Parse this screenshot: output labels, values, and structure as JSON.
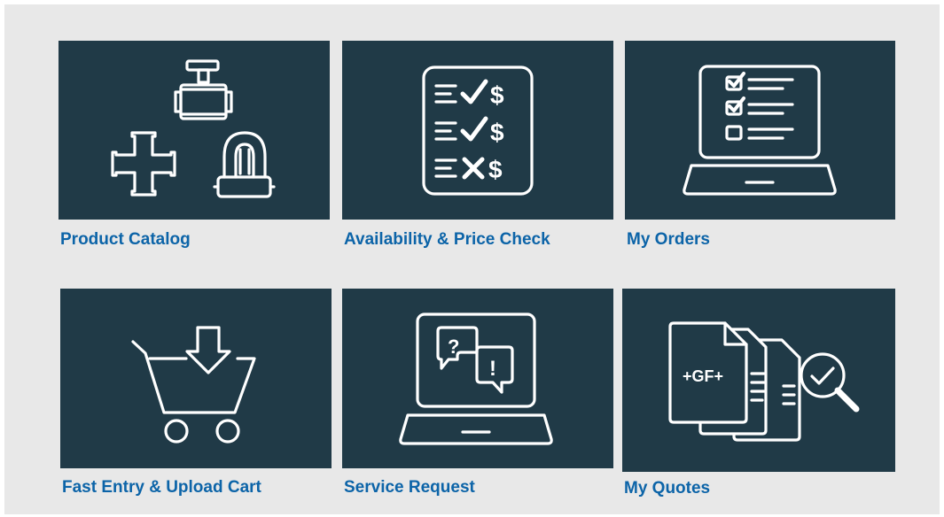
{
  "tiles": [
    {
      "label": "Product Catalog",
      "icon": "pipe-fittings-icon"
    },
    {
      "label": "Availability & Price Check",
      "icon": "price-checklist-icon"
    },
    {
      "label": "My Orders",
      "icon": "laptop-checklist-icon"
    },
    {
      "label": "Fast Entry & Upload Cart",
      "icon": "cart-upload-icon"
    },
    {
      "label": "Service Request",
      "icon": "laptop-chat-icon"
    },
    {
      "label": "My Quotes",
      "icon": "quote-documents-search-icon"
    }
  ],
  "icon_text": {
    "dollar": "$",
    "question": "?",
    "exclaim": "!",
    "gf_logo": "+GF+"
  },
  "colors": {
    "background": "#e8e8e8",
    "tile": "#203a47",
    "label": "#0c64a8",
    "icon": "#ffffff"
  }
}
